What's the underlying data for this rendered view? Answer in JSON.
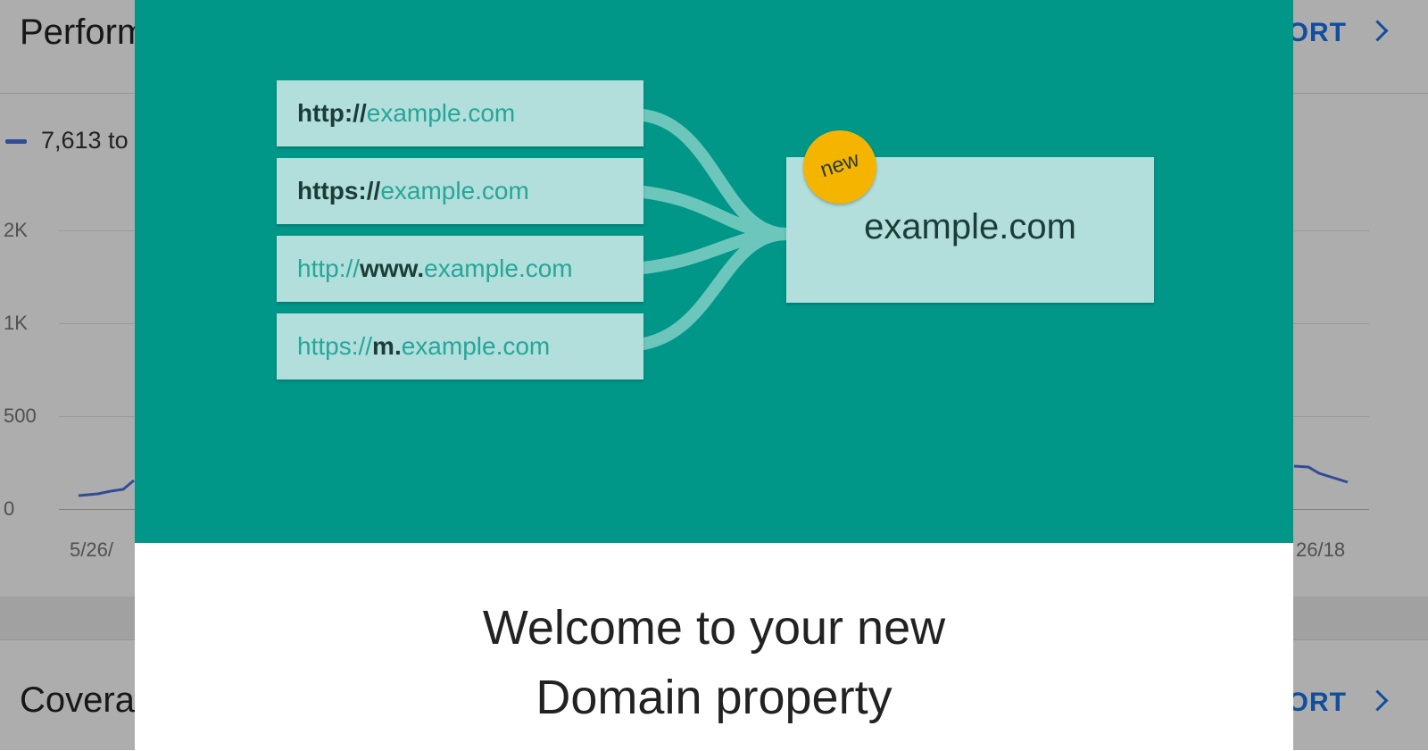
{
  "background": {
    "performance_title": "Perform",
    "performance_open_report": "PORT",
    "legend_total": "7,613 to",
    "y_ticks": [
      "2K",
      "1K",
      "500",
      "0"
    ],
    "x_tick_left": "5/26/",
    "x_tick_right": "26/18",
    "coverage_title": "Covera",
    "coverage_open_report": "PORT",
    "series_color": "#4a6fe0"
  },
  "modal": {
    "urls": [
      {
        "parts": [
          {
            "text": "http://",
            "style": "dark"
          },
          {
            "text": "example.com",
            "style": "teal"
          }
        ]
      },
      {
        "parts": [
          {
            "text": "https://",
            "style": "dark"
          },
          {
            "text": "example.com",
            "style": "teal"
          }
        ]
      },
      {
        "parts": [
          {
            "text": "http://",
            "style": "teal"
          },
          {
            "text": "www.",
            "style": "dark"
          },
          {
            "text": "example.com",
            "style": "teal"
          }
        ]
      },
      {
        "parts": [
          {
            "text": "https://",
            "style": "teal"
          },
          {
            "text": "m.",
            "style": "dark"
          },
          {
            "text": "example.com",
            "style": "teal"
          }
        ]
      }
    ],
    "target_domain": "example.com",
    "badge": "new",
    "welcome_line1": "Welcome to your new",
    "welcome_line2": "Domain property",
    "colors": {
      "hero": "#009688",
      "box": "#b2dfdb",
      "badge": "#f4b400"
    }
  }
}
